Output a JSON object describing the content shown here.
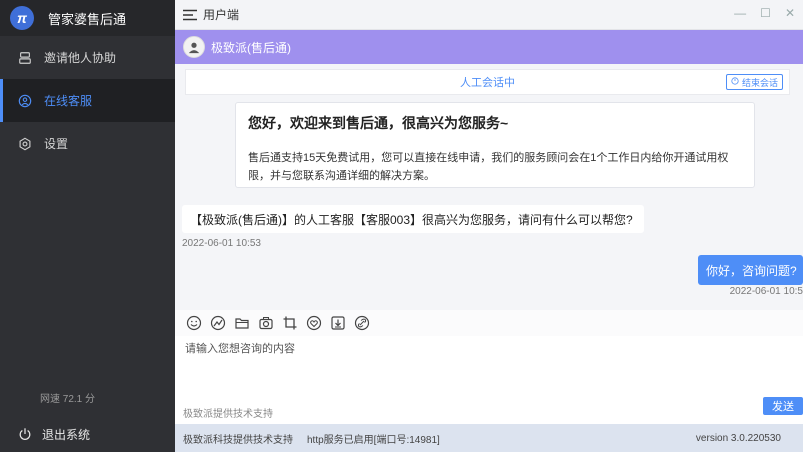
{
  "app": {
    "title": "管家婆售后通",
    "logo_glyph": "π"
  },
  "sidebar": {
    "items": [
      {
        "label": "邀请他人协助",
        "icon": "invite-icon",
        "active": false
      },
      {
        "label": "在线客服",
        "icon": "user-circle-icon",
        "active": true
      },
      {
        "label": "设置",
        "icon": "gear-icon",
        "active": false
      }
    ],
    "speed": "网速 72.1 分",
    "logout": "退出系统"
  },
  "topbar": {
    "title": "用户端"
  },
  "chat": {
    "contact": "极致派(售后通)",
    "status": "人工会话中",
    "end_button": "结束会话",
    "welcome_title": "您好，欢迎来到售后通，很高兴为您服务~",
    "welcome_body": "售后通支持15天免费试用，您可以直接在线申请，我们的服务顾问会在1个工作日内给你开通试用权限，并与您联系沟通详细的解决方案。",
    "agent_message": "【极致派(售后通)】的人工客服【客服003】很高兴为您服务，请问有什么可以帮您?",
    "agent_time": "2022-06-01 10:53",
    "user_message": "你好，咨询问题?",
    "user_time": "2022-06-01 10:5"
  },
  "input": {
    "placeholder": "请输入您想咨询的内容",
    "send": "发送"
  },
  "powered_by": "极致派提供技术支持",
  "footer": {
    "tech": "极致派科技提供技术支持",
    "http": "http服务已启用[端口号:14981]",
    "version": "version 3.0.220530"
  },
  "colors": {
    "accent": "#4e8ef7",
    "header": "#9f90ee",
    "sidebar": "#2f3034"
  }
}
